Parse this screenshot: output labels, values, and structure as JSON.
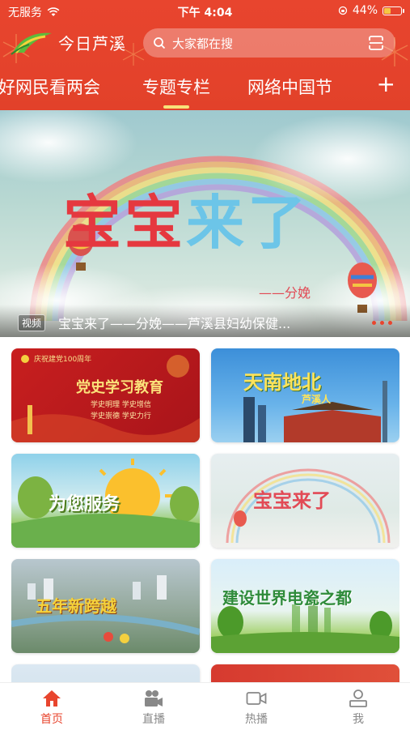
{
  "status_bar": {
    "carrier": "无服务",
    "time": "下午 4:04",
    "battery": "44%",
    "battery_level": 0.44
  },
  "app": {
    "name": "今日芦溪"
  },
  "search": {
    "placeholder": "大家都在搜"
  },
  "tabs": [
    {
      "label": "好网民看两会"
    },
    {
      "label": "专题专栏",
      "active": true
    },
    {
      "label": "网络中国节"
    }
  ],
  "banner": {
    "title_part1": "宝宝",
    "title_part2": "来了",
    "subtitle": "——分娩",
    "tag": "视频",
    "caption": "宝宝来了——分娩——芦溪县妇幼保健..."
  },
  "cards": [
    {
      "label": "党史学习教育",
      "badge": "庆祝建党100周年",
      "lines": [
        "学史明理 学史增信",
        "学史崇德 学史力行"
      ]
    },
    {
      "label": "天南地北",
      "sub": "芦溪人"
    },
    {
      "label": "为您服务"
    },
    {
      "label": "宝宝来了"
    },
    {
      "label": "五年新跨越"
    },
    {
      "label": "建设世界电瓷之都"
    }
  ],
  "bottom_nav": [
    {
      "label": "首页",
      "icon": "home-icon",
      "active": true
    },
    {
      "label": "直播",
      "icon": "camera-icon"
    },
    {
      "label": "热播",
      "icon": "video-icon"
    },
    {
      "label": "我",
      "icon": "user-icon"
    }
  ],
  "colors": {
    "brand_red": "#e8452e",
    "tab_indicator": "#f8e27a"
  }
}
